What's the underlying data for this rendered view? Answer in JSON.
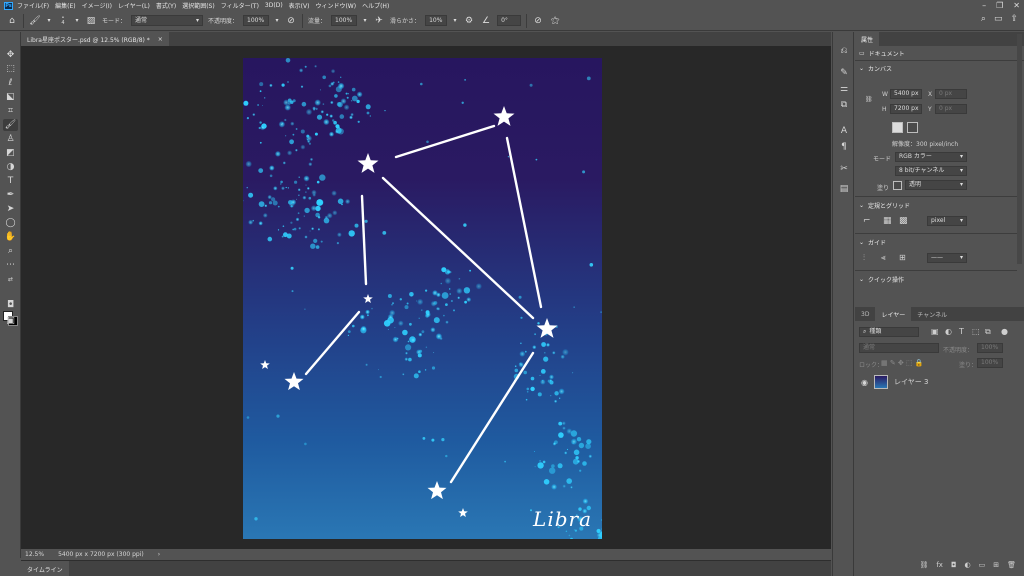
{
  "app": {
    "logo": "Ps",
    "menu": [
      "ファイル(F)",
      "編集(E)",
      "イメージ(I)",
      "レイヤー(L)",
      "書式(Y)",
      "選択範囲(S)",
      "フィルター(T)",
      "3D(D)",
      "表示(V)",
      "ウィンドウ(W)",
      "ヘルプ(H)"
    ]
  },
  "options": {
    "brush_size": "4",
    "mode_label": "モード：",
    "mode_value": "通常",
    "opacity_label": "不透明度：",
    "opacity_value": "100%",
    "flow_label": "流量：",
    "flow_value": "100%",
    "smoothing_label": "滑らかさ：",
    "smoothing_value": "10%",
    "angle_value": "0°"
  },
  "document": {
    "tab_title": "Libra星座ポスター.psd @ 12.5% (RGB/8) *",
    "close_glyph": "×",
    "artwork_text": "Libra"
  },
  "status": {
    "zoom": "12.5%",
    "doc_info": "5400 px x 7200 px (300 ppi)",
    "arrow": "›"
  },
  "timeline": {
    "tab": "タイムライン"
  },
  "properties": {
    "tab": "属性",
    "doc_label": "ドキュメント",
    "canvas_section": "カンバス",
    "w_label": "W",
    "w_value": "5400 px",
    "x_label": "X",
    "x_placeholder": "0 px",
    "h_label": "H",
    "h_value": "7200 px",
    "y_label": "Y",
    "y_placeholder": "0 px",
    "resolution": "解像度：300 pixel/inch",
    "mode_label": "モード",
    "mode_value": "RGB カラー",
    "bit_value": "8 bit/チャンネル",
    "fill_label": "塗り",
    "fill_value": "透明",
    "rulers_section": "定規とグリッド",
    "ruler_unit": "pixel",
    "guides_section": "ガイド",
    "quick_section": "クイック操作"
  },
  "layers": {
    "tabs": [
      "3D",
      "レイヤー",
      "チャンネル"
    ],
    "kind_label": "種類",
    "blend_value": "通常",
    "opacity_label": "不透明度：",
    "opacity_value": "100%",
    "lock_label": "ロック：",
    "fill_label": "塗り：",
    "fill_value": "100%",
    "layer_name": "レイヤー 3"
  }
}
